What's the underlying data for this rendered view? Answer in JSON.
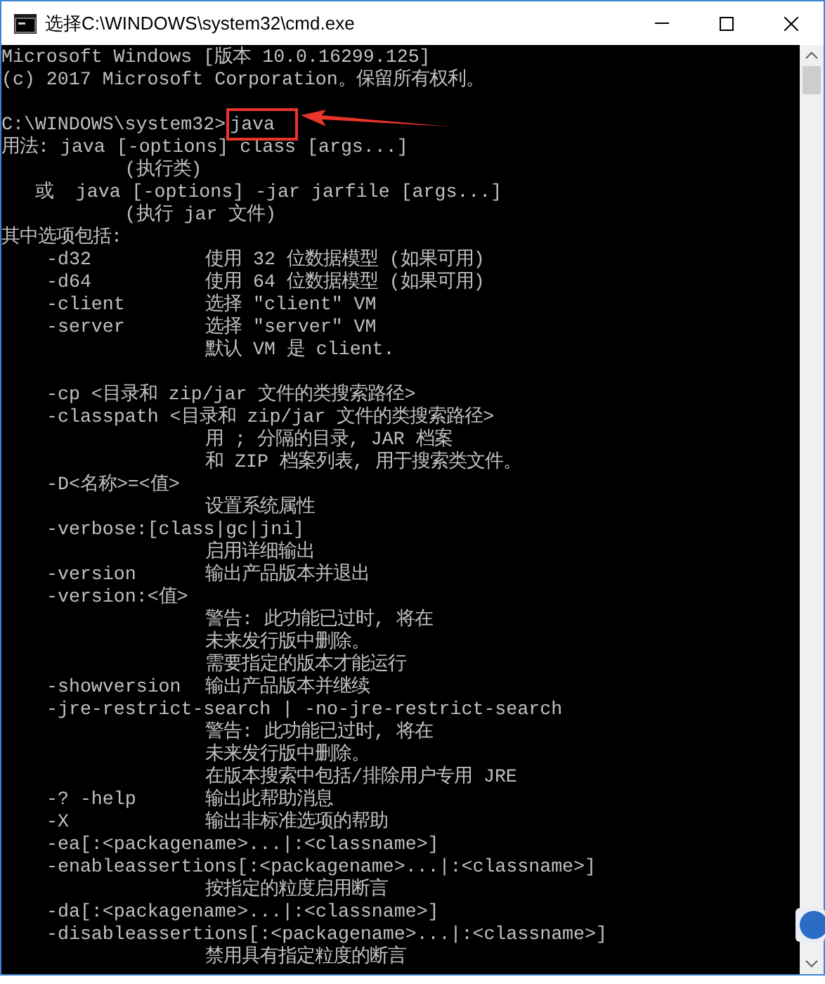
{
  "window": {
    "title": "选择C:\\WINDOWS\\system32\\cmd.exe"
  },
  "blocks": [
    [
      {
        "text": "Microsoft Windows [版本 10.0.16299.125]"
      },
      {
        "text": "(c) 2017 Microsoft Corporation。保留所有权利。"
      }
    ],
    [
      {
        "prompt": "C:\\WINDOWS\\system32>",
        "command": "java",
        "highlighted": true
      },
      {
        "text": "用法: java [-options] class [args...]"
      },
      {
        "text": "           (执行类)"
      },
      {
        "text": "   或  java [-options] -jar jarfile [args...]"
      },
      {
        "text": "           (执行 jar 文件)"
      },
      {
        "text": "其中选项包括:"
      },
      {
        "option": "-d32",
        "description": "使用 32 位数据模型 (如果可用)"
      },
      {
        "option": "-d64",
        "description": "使用 64 位数据模型 (如果可用)"
      },
      {
        "option": "-client",
        "description": "选择 \"client\" VM"
      },
      {
        "option": "-server",
        "description": "选择 \"server\" VM"
      },
      {
        "description": "默认 VM 是 client."
      }
    ],
    [
      {
        "option": "-cp <目录和 zip/jar 文件的类搜索路径>"
      },
      {
        "option": "-classpath <目录和 zip/jar 文件的类搜索路径>"
      },
      {
        "description": "用 ; 分隔的目录, JAR 档案"
      },
      {
        "description": "和 ZIP 档案列表, 用于搜索类文件。"
      },
      {
        "option": "-D<名称>=<值>"
      },
      {
        "description": "设置系统属性"
      },
      {
        "option": "-verbose:[class|gc|jni]"
      },
      {
        "description": "启用详细输出"
      },
      {
        "option": "-version",
        "description": "输出产品版本并退出"
      },
      {
        "option": "-version:<值>"
      },
      {
        "description": "警告: 此功能已过时, 将在"
      },
      {
        "description": "未来发行版中删除。"
      },
      {
        "description": "需要指定的版本才能运行"
      },
      {
        "option": "-showversion",
        "description": "输出产品版本并继续"
      },
      {
        "option": "-jre-restrict-search | -no-jre-restrict-search"
      },
      {
        "description": "警告: 此功能已过时, 将在"
      },
      {
        "description": "未来发行版中删除。"
      },
      {
        "description": "在版本搜索中包括/排除用户专用 JRE"
      },
      {
        "option": "-? -help",
        "description": "输出此帮助消息"
      },
      {
        "option": "-X",
        "description": "输出非标准选项的帮助"
      },
      {
        "option": "-ea[:<packagename>...|:<classname>]"
      },
      {
        "option": "-enableassertions[:<packagename>...|:<classname>]"
      },
      {
        "description": "按指定的粒度启用断言"
      },
      {
        "option": "-da[:<packagename>...|:<classname>]"
      },
      {
        "option": "-disableassertions[:<packagename>...|:<classname>]"
      },
      {
        "description": "禁用具有指定粒度的断言"
      }
    ]
  ]
}
